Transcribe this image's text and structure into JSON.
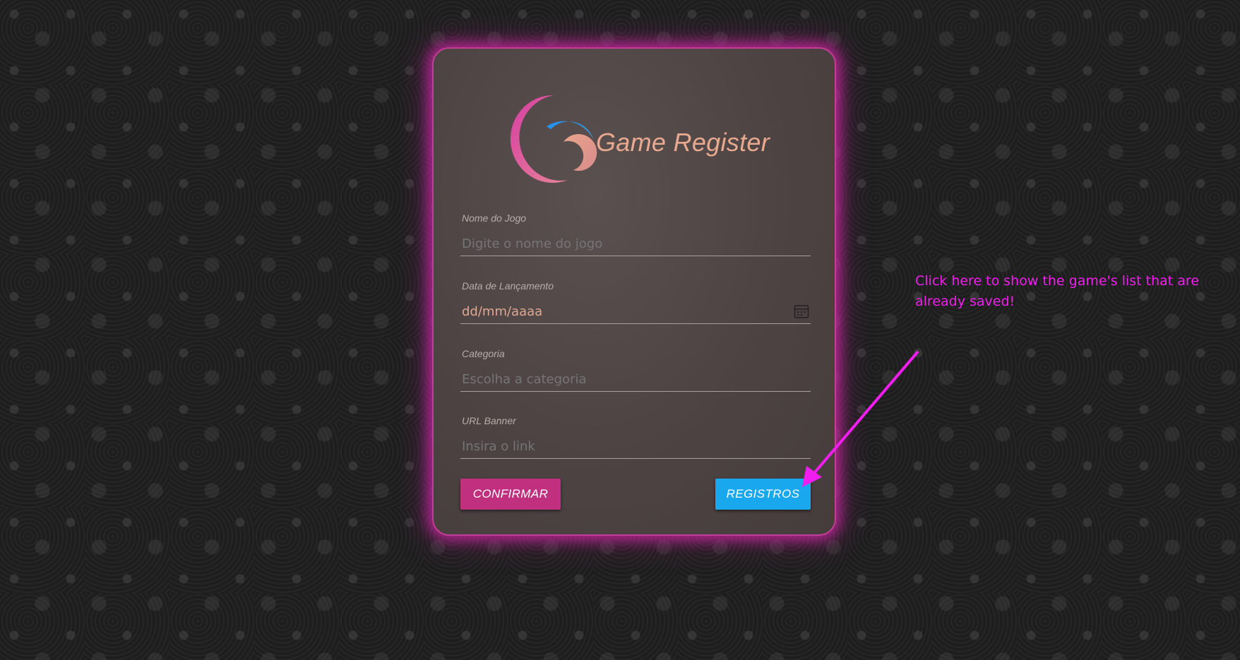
{
  "app": {
    "title": "Game Register",
    "logo": "crescent-swirl-logo"
  },
  "form": {
    "name": {
      "label": "Nome do Jogo",
      "placeholder": "Digite o nome do jogo",
      "value": ""
    },
    "release_date": {
      "label": "Data de Lançamento",
      "value": "dd/mm/aaaa",
      "icon": "calendar-icon"
    },
    "category": {
      "label": "Categoria",
      "placeholder": "Escolha a categoria",
      "value": ""
    },
    "banner_url": {
      "label": "URL Banner",
      "placeholder": "Insira o link",
      "value": ""
    }
  },
  "buttons": {
    "confirm_label": "CONFIRMAR",
    "registros_label": "REGISTROS"
  },
  "annotation": {
    "text": "Click here to show the game's list that are already saved!"
  },
  "colors": {
    "accent_pink": "#c0307f",
    "accent_blue": "#19a7ee",
    "glow": "#d428aa",
    "title_text": "#e9a98e",
    "annotation": "#f21df0"
  }
}
